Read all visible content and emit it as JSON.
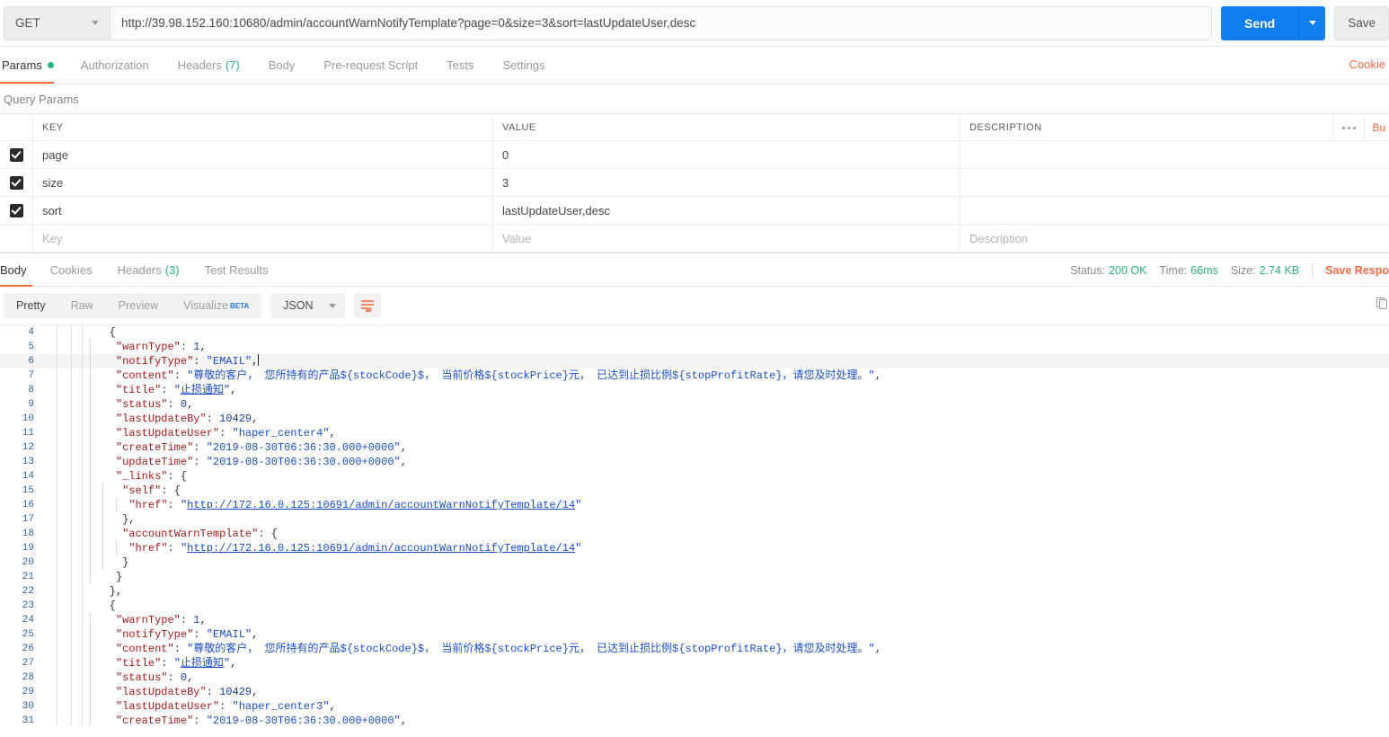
{
  "request": {
    "method": "GET",
    "url": "http://39.98.152.160:10680/admin/accountWarnNotifyTemplate?page=0&size=3&sort=lastUpdateUser,desc",
    "send_label": "Send",
    "save_label": "Save",
    "tabs": [
      {
        "label": "Params",
        "badge": "dot",
        "active": true
      },
      {
        "label": "Authorization",
        "badge": "",
        "active": false
      },
      {
        "label": "Headers",
        "badge": "(7)",
        "active": false
      },
      {
        "label": "Body",
        "badge": "",
        "active": false
      },
      {
        "label": "Pre-request Script",
        "badge": "",
        "active": false
      },
      {
        "label": "Tests",
        "badge": "",
        "active": false
      },
      {
        "label": "Settings",
        "badge": "",
        "active": false
      }
    ],
    "cookies_link": "Cookie"
  },
  "query_params": {
    "section_title": "Query Params",
    "columns": [
      "KEY",
      "VALUE",
      "DESCRIPTION"
    ],
    "bulk_edit_label": "Bu",
    "rows": [
      {
        "checked": true,
        "key": "page",
        "value": "0",
        "description": ""
      },
      {
        "checked": true,
        "key": "size",
        "value": "3",
        "description": ""
      },
      {
        "checked": true,
        "key": "sort",
        "value": "lastUpdateUser,desc",
        "description": ""
      }
    ],
    "empty_row": {
      "key": "Key",
      "value": "Value",
      "description": "Description"
    }
  },
  "response": {
    "tabs": [
      {
        "label": "Body",
        "badge": "",
        "active": true
      },
      {
        "label": "Cookies",
        "badge": "",
        "active": false
      },
      {
        "label": "Headers",
        "badge": "(3)",
        "active": false
      },
      {
        "label": "Test Results",
        "badge": "",
        "active": false
      }
    ],
    "status_label": "Status:",
    "status_value": "200 OK",
    "time_label": "Time:",
    "time_value": "66ms",
    "size_label": "Size:",
    "size_value": "2.74 KB",
    "save_response_label": "Save Respo",
    "view_modes": [
      {
        "label": "Pretty",
        "active": true
      },
      {
        "label": "Raw",
        "active": false
      },
      {
        "label": "Preview",
        "active": false
      },
      {
        "label": "Visualize",
        "active": false,
        "beta": "BETA"
      }
    ],
    "format": "JSON"
  },
  "colors": {
    "accent": "#ff6c37",
    "send_blue": "#0f7ef0",
    "status_green": "#2ab27b",
    "json_key": "#a11c1c",
    "json_string": "#1a4ecb",
    "json_number": "#1b3fa0"
  },
  "code": {
    "content_string": "\"尊敬的客户， 您所持有的产品${stockCode}$， 当前价格${stockPrice}元， 已达到止损比例${stopProfitRate}，请您及时处理。\"",
    "title_string": "止损通知",
    "href_url": "http://172.16.0.125:10691/admin/accountWarnNotifyTemplate/14",
    "lines": [
      {
        "n": 4,
        "indent": 3,
        "guides": 0,
        "html": "<span class=\"p\">{</span>"
      },
      {
        "n": 5,
        "indent": 4,
        "guides": 1,
        "html": "<span class=\"k\">\"warnType\"</span><span class=\"p\">: </span><span class=\"n\">1</span><span class=\"p\">,</span>"
      },
      {
        "n": 6,
        "indent": 4,
        "guides": 1,
        "hl": true,
        "html": "<span class=\"k\">\"notifyType\"</span><span class=\"p\">: </span><span class=\"s\">\"EMAIL\"</span><span class=\"p\">,</span><span class=\"cursor\"></span>"
      },
      {
        "n": 7,
        "indent": 4,
        "guides": 1,
        "html": "<span class=\"k\">\"content\"</span><span class=\"p\">: </span><span class=\"s\">\"尊敬的客户， 您所持有的产品${stockCode}$， 当前价格${stockPrice}元， 已达到止损比例${stopProfitRate}，请您及时处理。\"</span><span class=\"p\">,</span>"
      },
      {
        "n": 8,
        "indent": 4,
        "guides": 1,
        "html": "<span class=\"k\">\"title\"</span><span class=\"p\">: </span><span class=\"s\">\"<span class=\"sp\">止损通知</span>\"</span><span class=\"p\">,</span>"
      },
      {
        "n": 9,
        "indent": 4,
        "guides": 1,
        "html": "<span class=\"k\">\"status\"</span><span class=\"p\">: </span><span class=\"n\">0</span><span class=\"p\">,</span>"
      },
      {
        "n": 10,
        "indent": 4,
        "guides": 1,
        "html": "<span class=\"k\">\"lastUpdateBy\"</span><span class=\"p\">: </span><span class=\"n\">10429</span><span class=\"p\">,</span>"
      },
      {
        "n": 11,
        "indent": 4,
        "guides": 1,
        "html": "<span class=\"k\">\"lastUpdateUser\"</span><span class=\"p\">: </span><span class=\"s\">\"haper_center4\"</span><span class=\"p\">,</span>"
      },
      {
        "n": 12,
        "indent": 4,
        "guides": 1,
        "html": "<span class=\"k\">\"createTime\"</span><span class=\"p\">: </span><span class=\"s\">\"2019-08-30T06:36:30.000+0000\"</span><span class=\"p\">,</span>"
      },
      {
        "n": 13,
        "indent": 4,
        "guides": 1,
        "html": "<span class=\"k\">\"updateTime\"</span><span class=\"p\">: </span><span class=\"s\">\"2019-08-30T06:36:30.000+0000\"</span><span class=\"p\">,</span>"
      },
      {
        "n": 14,
        "indent": 4,
        "guides": 1,
        "html": "<span class=\"k\">\"_links\"</span><span class=\"p\">: {</span>"
      },
      {
        "n": 15,
        "indent": 5,
        "guides": 2,
        "html": "<span class=\"k\">\"self\"</span><span class=\"p\">: {</span>"
      },
      {
        "n": 16,
        "indent": 6,
        "guides": 3,
        "html": "<span class=\"k\">\"href\"</span><span class=\"p\">: </span><span class=\"s\">\"<span class=\"lnk\">http://172.16.0.125:10691/admin/accountWarnNotifyTemplate/14</span>\"</span>"
      },
      {
        "n": 17,
        "indent": 5,
        "guides": 2,
        "html": "<span class=\"p\">},</span>"
      },
      {
        "n": 18,
        "indent": 5,
        "guides": 2,
        "html": "<span class=\"k\">\"accountWarnTemplate\"</span><span class=\"p\">: {</span>"
      },
      {
        "n": 19,
        "indent": 6,
        "guides": 3,
        "html": "<span class=\"k\">\"href\"</span><span class=\"p\">: </span><span class=\"s\">\"<span class=\"lnk\">http://172.16.0.125:10691/admin/accountWarnNotifyTemplate/14</span>\"</span>"
      },
      {
        "n": 20,
        "indent": 5,
        "guides": 2,
        "html": "<span class=\"p\">}</span>"
      },
      {
        "n": 21,
        "indent": 4,
        "guides": 1,
        "html": "<span class=\"p\">}</span>"
      },
      {
        "n": 22,
        "indent": 3,
        "guides": 0,
        "html": "<span class=\"p\">},</span>"
      },
      {
        "n": 23,
        "indent": 3,
        "guides": 0,
        "html": "<span class=\"p\">{</span>"
      },
      {
        "n": 24,
        "indent": 4,
        "guides": 1,
        "html": "<span class=\"k\">\"warnType\"</span><span class=\"p\">: </span><span class=\"n\">1</span><span class=\"p\">,</span>"
      },
      {
        "n": 25,
        "indent": 4,
        "guides": 1,
        "html": "<span class=\"k\">\"notifyType\"</span><span class=\"p\">: </span><span class=\"s\">\"EMAIL\"</span><span class=\"p\">,</span>"
      },
      {
        "n": 26,
        "indent": 4,
        "guides": 1,
        "html": "<span class=\"k\">\"content\"</span><span class=\"p\">: </span><span class=\"s\">\"尊敬的客户， 您所持有的产品${stockCode}$， 当前价格${stockPrice}元， 已达到止损比例${stopProfitRate}，请您及时处理。\"</span><span class=\"p\">,</span>"
      },
      {
        "n": 27,
        "indent": 4,
        "guides": 1,
        "html": "<span class=\"k\">\"title\"</span><span class=\"p\">: </span><span class=\"s\">\"<span class=\"sp\">止损通知</span>\"</span><span class=\"p\">,</span>"
      },
      {
        "n": 28,
        "indent": 4,
        "guides": 1,
        "html": "<span class=\"k\">\"status\"</span><span class=\"p\">: </span><span class=\"n\">0</span><span class=\"p\">,</span>"
      },
      {
        "n": 29,
        "indent": 4,
        "guides": 1,
        "html": "<span class=\"k\">\"lastUpdateBy\"</span><span class=\"p\">: </span><span class=\"n\">10429</span><span class=\"p\">,</span>"
      },
      {
        "n": 30,
        "indent": 4,
        "guides": 1,
        "html": "<span class=\"k\">\"lastUpdateUser\"</span><span class=\"p\">: </span><span class=\"s\">\"haper_center3\"</span><span class=\"p\">,</span>"
      },
      {
        "n": 31,
        "indent": 4,
        "guides": 1,
        "html": "<span class=\"k\">\"createTime\"</span><span class=\"p\">: </span><span class=\"s\">\"2019-08-30T06:36:30.000+0000\"</span><span class=\"p\">,</span>"
      }
    ]
  }
}
